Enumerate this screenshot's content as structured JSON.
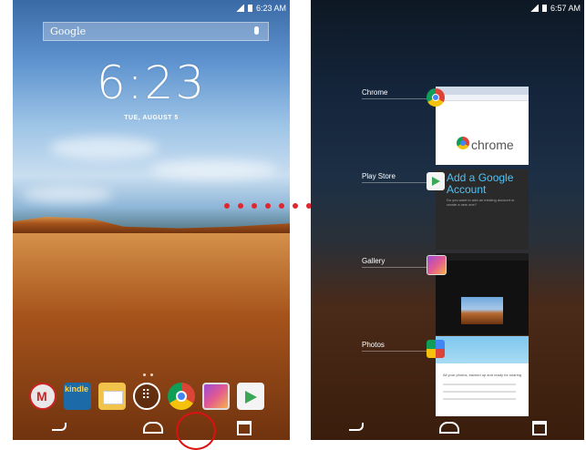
{
  "home_screen": {
    "status_time": "6:23 AM",
    "search_label": "Google",
    "clock": "6:23",
    "date": "TUE, AUGUST 5",
    "dock": [
      {
        "name": "Gmail",
        "icon": "gmail-icon"
      },
      {
        "name": "Kindle",
        "icon": "kindle-icon",
        "label": "kindle"
      },
      {
        "name": "Email",
        "icon": "email-icon"
      },
      {
        "name": "Apps",
        "icon": "app-drawer-icon"
      },
      {
        "name": "Chrome",
        "icon": "chrome-icon"
      },
      {
        "name": "Gallery",
        "icon": "gallery-icon"
      },
      {
        "name": "Play Store",
        "icon": "play-store-icon"
      }
    ],
    "highlighted_button": "recent-apps"
  },
  "recents_screen": {
    "status_time": "6:57 AM",
    "cards": [
      {
        "label": "Chrome",
        "content_text": "chrome"
      },
      {
        "label": "Play Store",
        "content_text": "Add a Google Account",
        "detail_text": "Do you want to add an existing account or create a new one?"
      },
      {
        "label": "Gallery"
      },
      {
        "label": "Photos",
        "content_text": "All your photos, backed up and ready for sharing"
      }
    ]
  },
  "colors": {
    "arrow": "#e0272d",
    "highlight_ring": "#dd1111",
    "store_title": "#4fc3f7"
  }
}
